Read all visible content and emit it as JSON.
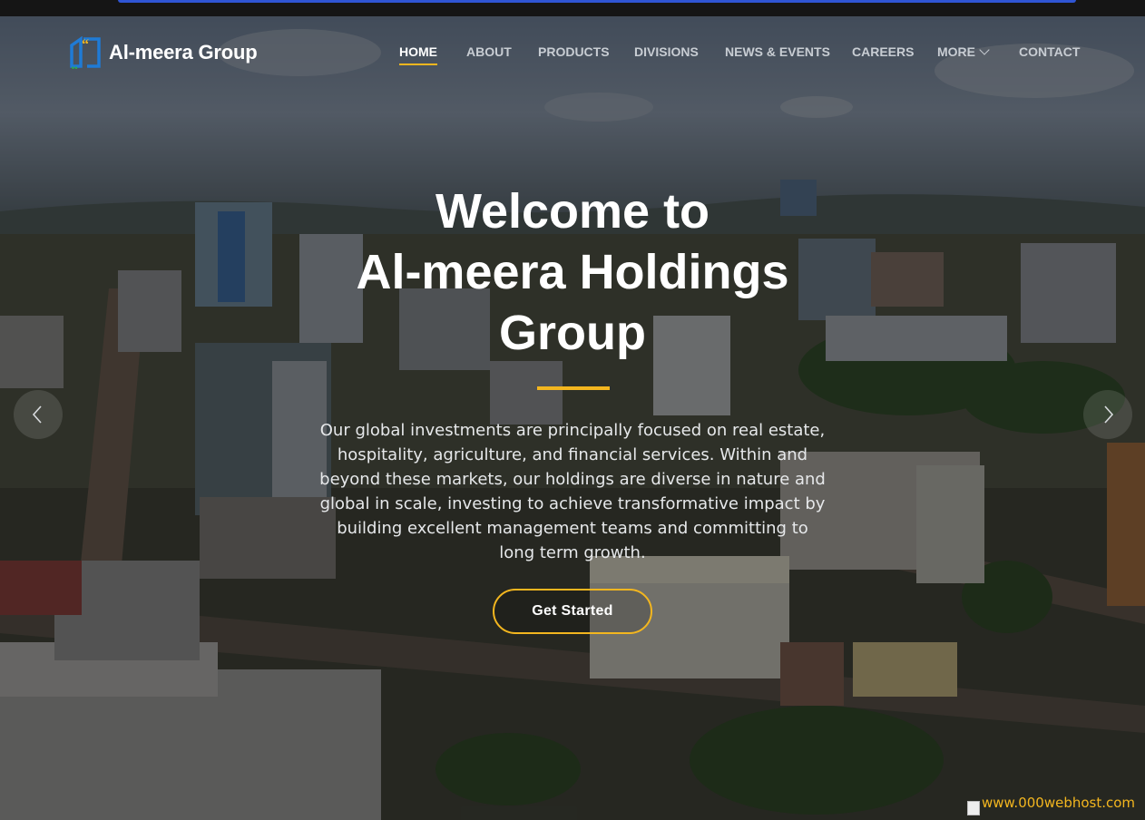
{
  "brand": {
    "name": "Al-meera Group",
    "colors": {
      "accent": "#f3b61f",
      "logo_blue": "#1f7bd6",
      "logo_green": "#2ea84f"
    }
  },
  "nav": {
    "items": [
      {
        "label": "HOME",
        "active": true
      },
      {
        "label": "ABOUT"
      },
      {
        "label": "PRODUCTS"
      },
      {
        "label": "DIVISIONS"
      },
      {
        "label": "NEWS & EVENTS"
      },
      {
        "label": "CAREERS"
      },
      {
        "label": "MORE",
        "dropdown": true
      },
      {
        "label": "CONTACT"
      }
    ]
  },
  "hero": {
    "headline_lines": [
      "Welcome to",
      "Al-meera Holdings",
      "Group"
    ],
    "lead": "Our global investments are principally focused on real estate, hospitality, agriculture, and financial services. Within and beyond these markets, our holdings are diverse in nature and global in scale, investing to achieve transformative impact by building excellent management teams and committing to long term growth.",
    "cta_label": "Get Started",
    "prev_icon": "chevron-left-icon",
    "next_icon": "chevron-right-icon"
  },
  "footer_badge": {
    "text": "www.000webhost.com"
  }
}
